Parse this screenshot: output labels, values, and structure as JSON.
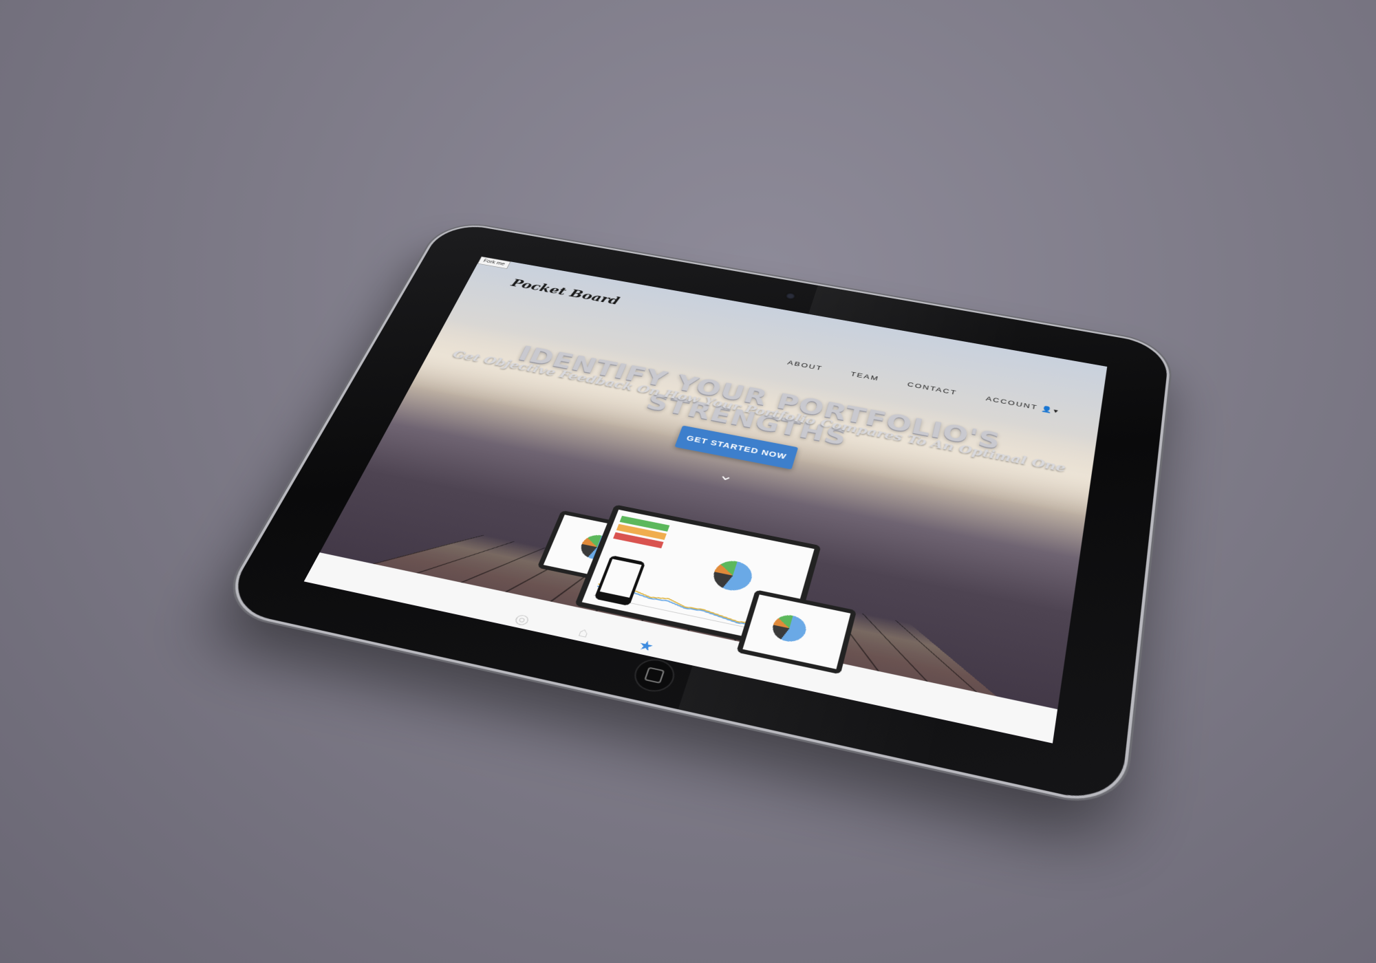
{
  "page": {
    "ribbon_label": "Fork me",
    "brand": "Pocket Board",
    "nav": [
      "ABOUT",
      "TEAM",
      "CONTACT",
      "ACCOUNT 👤▾"
    ],
    "headline": "IDENTIFY YOUR PORTFOLIO'S STRENGTHS",
    "subheadline": "Get Objective Feedback On How Your Portfolio Compares To An Optimal One",
    "cta_label": "GET STARTED NOW",
    "scroll_icon": "chevron-down-icon"
  },
  "dock_icons": [
    "camera-icon",
    "home-icon",
    "star-icon"
  ],
  "colors": {
    "cta": "#3d7fcc",
    "bezel": "#0d0d0e",
    "background": "#7e7b88",
    "tile_green": "#5cb85c",
    "tile_orange": "#f0ad4e",
    "tile_red": "#d9534f"
  }
}
